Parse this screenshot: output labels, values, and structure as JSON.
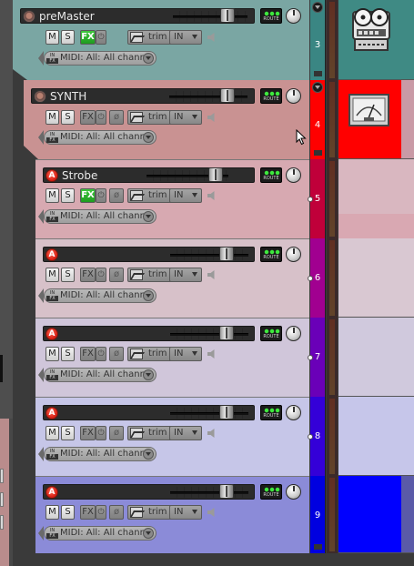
{
  "tracks": [
    {
      "id": "premaster",
      "name": "preMaster",
      "number": "3",
      "record_arm_style": "grey",
      "fx_active": true,
      "buttons": {
        "mute": "M",
        "solo": "S",
        "fx": "FX",
        "fx_power": "⏻",
        "trim": "trim",
        "input": "IN",
        "route": "ROUTE"
      },
      "midi_label": "MIDI: All: All chann",
      "color": "#4f908c",
      "item_color": "#3f8a84",
      "meter_color": "#3a8683",
      "icon": "tape-recorder-icon"
    },
    {
      "id": "synth",
      "name": "SYNTH",
      "number": "4",
      "record_arm_style": "grey",
      "fx_active": false,
      "buttons": {
        "mute": "M",
        "solo": "S",
        "fx": "FX",
        "fx_power": "⏻",
        "phase": "ø",
        "trim": "trim",
        "input": "IN",
        "route": "ROUTE"
      },
      "midi_label": "MIDI: All: All chann",
      "color": "#c98a8a",
      "item_color": "#ff0000",
      "meter_color": "#ff0000",
      "icon": "vu-meter-icon"
    },
    {
      "id": "strobe",
      "name": "Strobe",
      "number": "5",
      "record_arm_style": "red",
      "record_arm_label": "A",
      "fx_active": true,
      "buttons": {
        "mute": "M",
        "solo": "S",
        "fx": "FX",
        "fx_power": "⏻",
        "phase": "ø",
        "trim": "trim",
        "input": "IN",
        "route": "ROUTE"
      },
      "midi_label": "MIDI: All: All chann",
      "color": "#d9aab0",
      "item_color": "#d9b7c0",
      "meter_color": "#c0003a",
      "icon": ""
    },
    {
      "id": "track6",
      "name": "",
      "number": "6",
      "record_arm_style": "red",
      "record_arm_label": "A",
      "fx_active": false,
      "buttons": {
        "mute": "M",
        "solo": "S",
        "fx": "FX",
        "fx_power": "⏻",
        "phase": "ø",
        "trim": "trim",
        "input": "IN",
        "route": "ROUTE"
      },
      "midi_label": "MIDI: All: All chann",
      "color": "#dcc0c8",
      "item_color": "#d9c8d2",
      "meter_color": "#a10090",
      "icon": ""
    },
    {
      "id": "track7",
      "name": "",
      "number": "7",
      "record_arm_style": "red",
      "record_arm_label": "A",
      "fx_active": false,
      "buttons": {
        "mute": "M",
        "solo": "S",
        "fx": "FX",
        "fx_power": "⏻",
        "phase": "ø",
        "trim": "trim",
        "input": "IN",
        "route": "ROUTE"
      },
      "midi_label": "MIDI: All: All chann",
      "color": "#d2c6dc",
      "item_color": "#d0c9dd",
      "meter_color": "#6a00b8",
      "icon": ""
    },
    {
      "id": "track8",
      "name": "",
      "number": "8",
      "record_arm_style": "red",
      "record_arm_label": "A",
      "fx_active": false,
      "buttons": {
        "mute": "M",
        "solo": "S",
        "fx": "FX",
        "fx_power": "⏻",
        "phase": "ø",
        "trim": "trim",
        "input": "IN",
        "route": "ROUTE"
      },
      "midi_label": "MIDI: All: All chann",
      "color": "#c4c4e6",
      "item_color": "#c6c6ea",
      "meter_color": "#3400d8",
      "icon": ""
    },
    {
      "id": "track9",
      "name": "",
      "number": "9",
      "record_arm_style": "red",
      "record_arm_label": "A",
      "fx_active": false,
      "buttons": {
        "mute": "M",
        "solo": "S",
        "fx": "FX",
        "fx_power": "⏻",
        "phase": "ø",
        "trim": "trim",
        "input": "IN",
        "route": "ROUTE"
      },
      "midi_label": "MIDI: All: All chann",
      "color": "#8a8ad6",
      "item_color": "#0000ff",
      "meter_color": "#0000e0",
      "icon": ""
    }
  ]
}
